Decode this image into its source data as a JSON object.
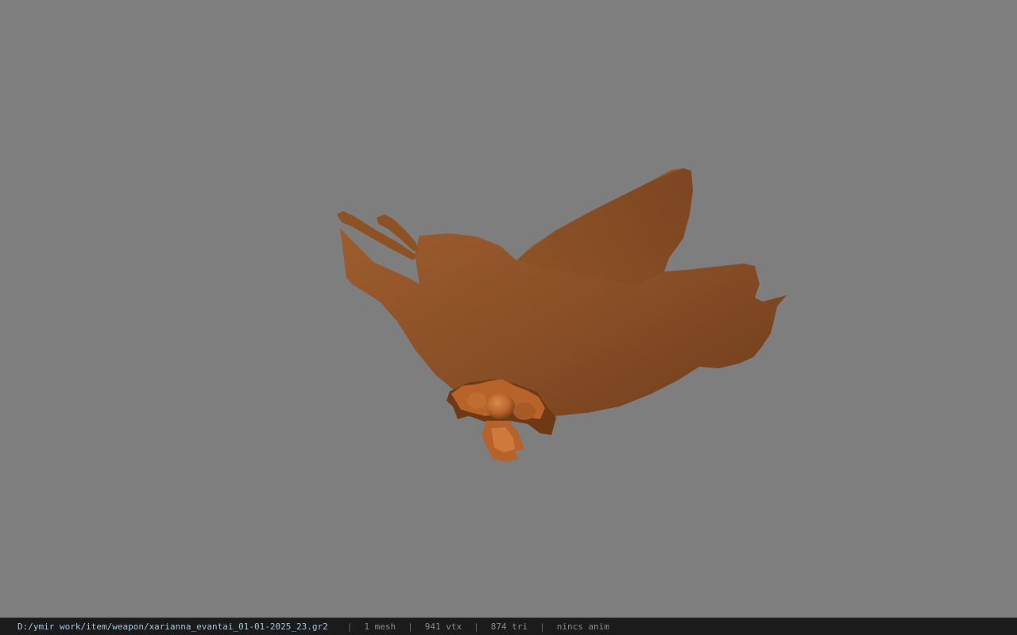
{
  "viewport": {
    "background_color": "#7e7e7e",
    "model": {
      "name_icon": "fan-model",
      "colors": {
        "light": "#a2602f",
        "mid": "#8a4f27",
        "dark": "#6e3d1c",
        "ornament_light": "#d07a3c",
        "ornament_dark": "#6e3a16"
      }
    }
  },
  "status_bar": {
    "file_path": "D:/ymir work/item/weapon/xarianna_evantai_01-01-2025_23.gr2",
    "separator": "|",
    "mesh_count": "1 mesh",
    "vertex_count": "941 vtx",
    "triangle_count": "874 tri",
    "animation": "nincs anim"
  }
}
